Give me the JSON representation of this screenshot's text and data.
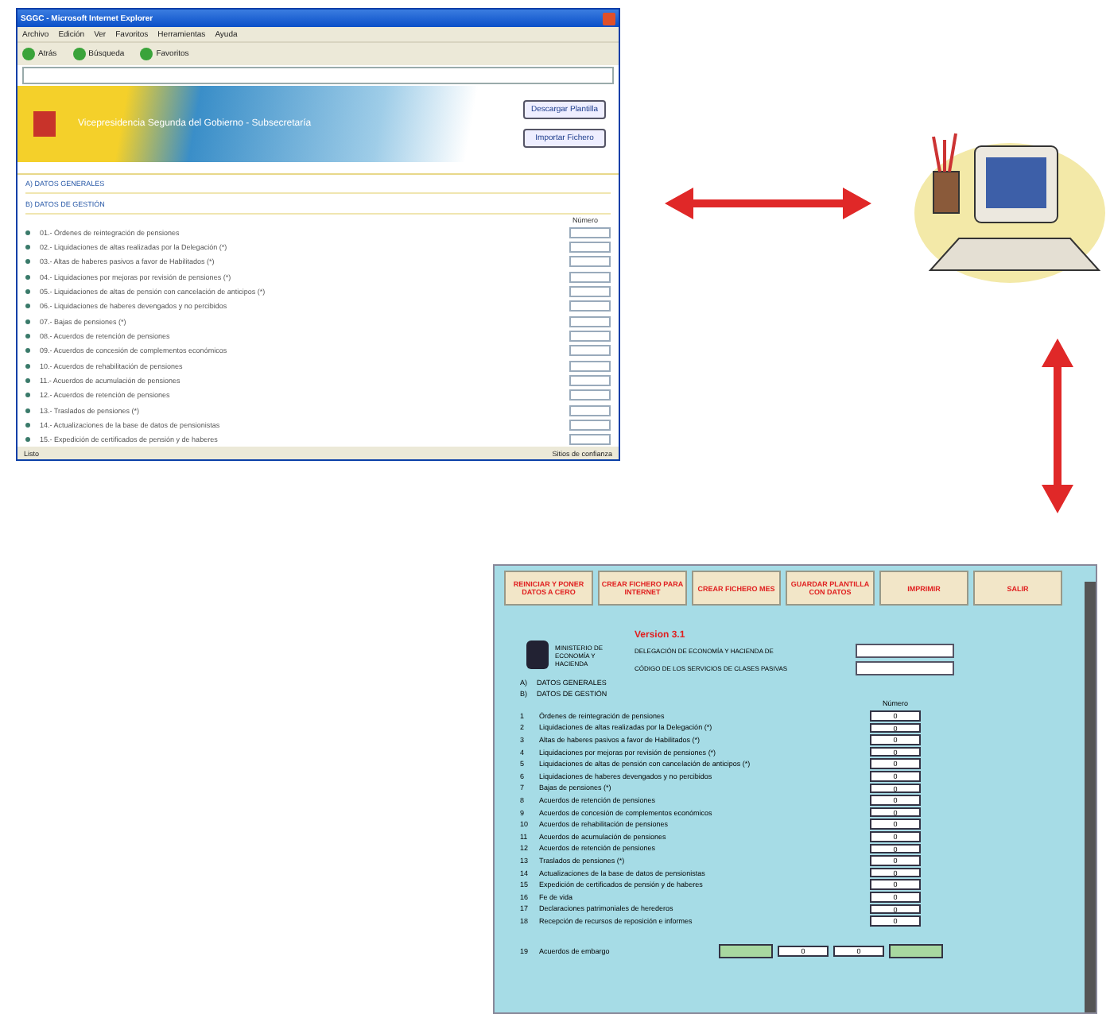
{
  "browser_window": {
    "title": "SGGC - Microsoft Internet Explorer",
    "menu": [
      "Archivo",
      "Edición",
      "Ver",
      "Favoritos",
      "Herramientas",
      "Ayuda"
    ],
    "toolbar": [
      "Atrás",
      "Búsqueda",
      "Favoritos"
    ],
    "header_title": "Vicepresidencia Segunda del Gobierno - Subsecretaría",
    "buttons": [
      "Descargar Plantilla",
      "Importar Fichero"
    ],
    "sections": [
      "A) DATOS GENERALES",
      "B) DATOS DE GESTIÓN"
    ],
    "column_header": "Número",
    "items": [
      "01.- Órdenes de reintegración de pensiones",
      "02.- Liquidaciones de altas realizadas por la Delegación (*)",
      "03.- Altas de haberes pasivos a favor de Habilitados (*)",
      "04.- Liquidaciones por mejoras por revisión de pensiones (*)",
      "05.- Liquidaciones de altas de pensión con cancelación de anticipos (*)",
      "06.- Liquidaciones de haberes devengados y no percibidos",
      "07.- Bajas de pensiones (*)",
      "08.- Acuerdos de retención de pensiones",
      "09.- Acuerdos de concesión de complementos económicos",
      "10.- Acuerdos de rehabilitación de pensiones",
      "11.- Acuerdos de acumulación de pensiones",
      "12.- Acuerdos de retención de pensiones",
      "13.- Traslados de pensiones (*)",
      "14.- Actualizaciones de la base de datos de pensionistas",
      "15.- Expedición de certificados de pensión y de haberes"
    ],
    "status": "Listo",
    "zone": "Sitios de confianza"
  },
  "spreadsheet_window": {
    "buttons": [
      "REINICIAR Y PONER DATOS A CERO",
      "CREAR FICHERO PARA INTERNET",
      "CREAR FICHERO MES",
      "GUARDAR PLANTILLA CON DATOS",
      "IMPRIMIR",
      "SALIR"
    ],
    "version": "Version 3.1",
    "ministry": "MINISTERIO DE ECONOMÍA Y HACIENDA",
    "form": [
      {
        "label": "DELEGACIÓN DE ECONOMÍA Y HACIENDA DE"
      },
      {
        "label": "CÓDIGO DE LOS SERVICIOS DE CLASES PASIVAS"
      }
    ],
    "sections": [
      {
        "letter": "A)",
        "title": "DATOS GENERALES"
      },
      {
        "letter": "B)",
        "title": "DATOS DE GESTIÓN"
      }
    ],
    "column_header": "Número",
    "rows": [
      {
        "number": "1",
        "label": "Órdenes de reintegración de pensiones",
        "value": "0"
      },
      {
        "number": "2",
        "label": "Liquidaciones de altas realizadas por la Delegación (*)",
        "value": "0"
      },
      {
        "number": "3",
        "label": "Altas de haberes pasivos a favor de Habilitados (*)",
        "value": "0"
      },
      {
        "number": "4",
        "label": "Liquidaciones por mejoras por revisión de pensiones (*)",
        "value": "0"
      },
      {
        "number": "5",
        "label": "Liquidaciones de altas de pensión con cancelación de anticipos (*)",
        "value": "0"
      },
      {
        "number": "6",
        "label": "Liquidaciones de haberes devengados y no percibidos",
        "value": "0"
      },
      {
        "number": "7",
        "label": "Bajas de pensiones (*)",
        "value": "0"
      },
      {
        "number": "8",
        "label": "Acuerdos de retención de pensiones",
        "value": "0"
      },
      {
        "number": "9",
        "label": "Acuerdos de concesión de complementos económicos",
        "value": "0"
      },
      {
        "number": "10",
        "label": "Acuerdos de rehabilitación de pensiones",
        "value": "0"
      },
      {
        "number": "11",
        "label": "Acuerdos de acumulación de pensiones",
        "value": "0"
      },
      {
        "number": "12",
        "label": "Acuerdos de retención de pensiones",
        "value": "0"
      },
      {
        "number": "13",
        "label": "Traslados de pensiones (*)",
        "value": "0"
      },
      {
        "number": "14",
        "label": "Actualizaciones de la base de datos de pensionistas",
        "value": "0"
      },
      {
        "number": "15",
        "label": "Expedición de certificados de pensión y de haberes",
        "value": "0"
      },
      {
        "number": "16",
        "label": "Fe de vida",
        "value": "0"
      },
      {
        "number": "17",
        "label": "Declaraciones patrimoniales de herederos",
        "value": "0"
      },
      {
        "number": "18",
        "label": "Recepción de recursos de reposición e informes",
        "value": "0"
      }
    ],
    "embargo": {
      "number": "19",
      "label": "Acuerdos de embargo",
      "values": [
        "0",
        "0"
      ]
    }
  }
}
